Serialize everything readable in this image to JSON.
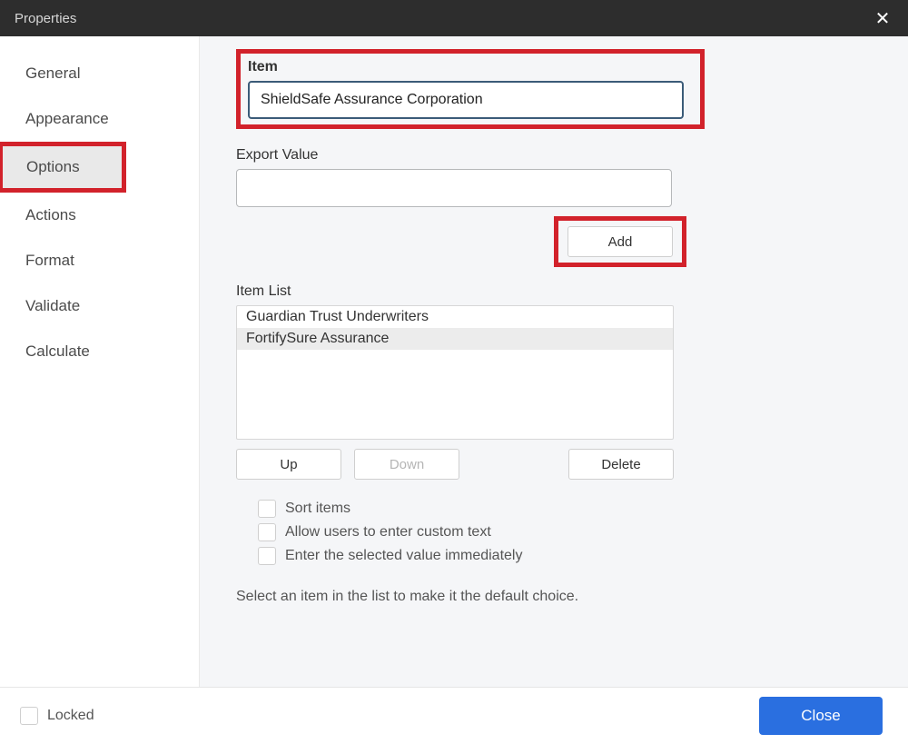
{
  "window": {
    "title": "Properties"
  },
  "sidebar": {
    "items": [
      {
        "label": "General"
      },
      {
        "label": "Appearance"
      },
      {
        "label": "Options"
      },
      {
        "label": "Actions"
      },
      {
        "label": "Format"
      },
      {
        "label": "Validate"
      },
      {
        "label": "Calculate"
      }
    ],
    "active_index": 2
  },
  "options_panel": {
    "item_label": "Item",
    "item_value": "ShieldSafe Assurance Corporation",
    "export_label": "Export Value",
    "export_value": "",
    "add_label": "Add",
    "item_list_label": "Item List",
    "item_list": [
      "Guardian Trust Underwriters",
      "FortifySure Assurance"
    ],
    "up_label": "Up",
    "down_label": "Down",
    "delete_label": "Delete",
    "checkboxes": {
      "sort": "Sort items",
      "custom": "Allow users to enter custom text",
      "immediate": "Enter the selected value immediately"
    },
    "hint": "Select an item in the list to make it the default choice."
  },
  "footer": {
    "locked_label": "Locked",
    "close_label": "Close"
  }
}
